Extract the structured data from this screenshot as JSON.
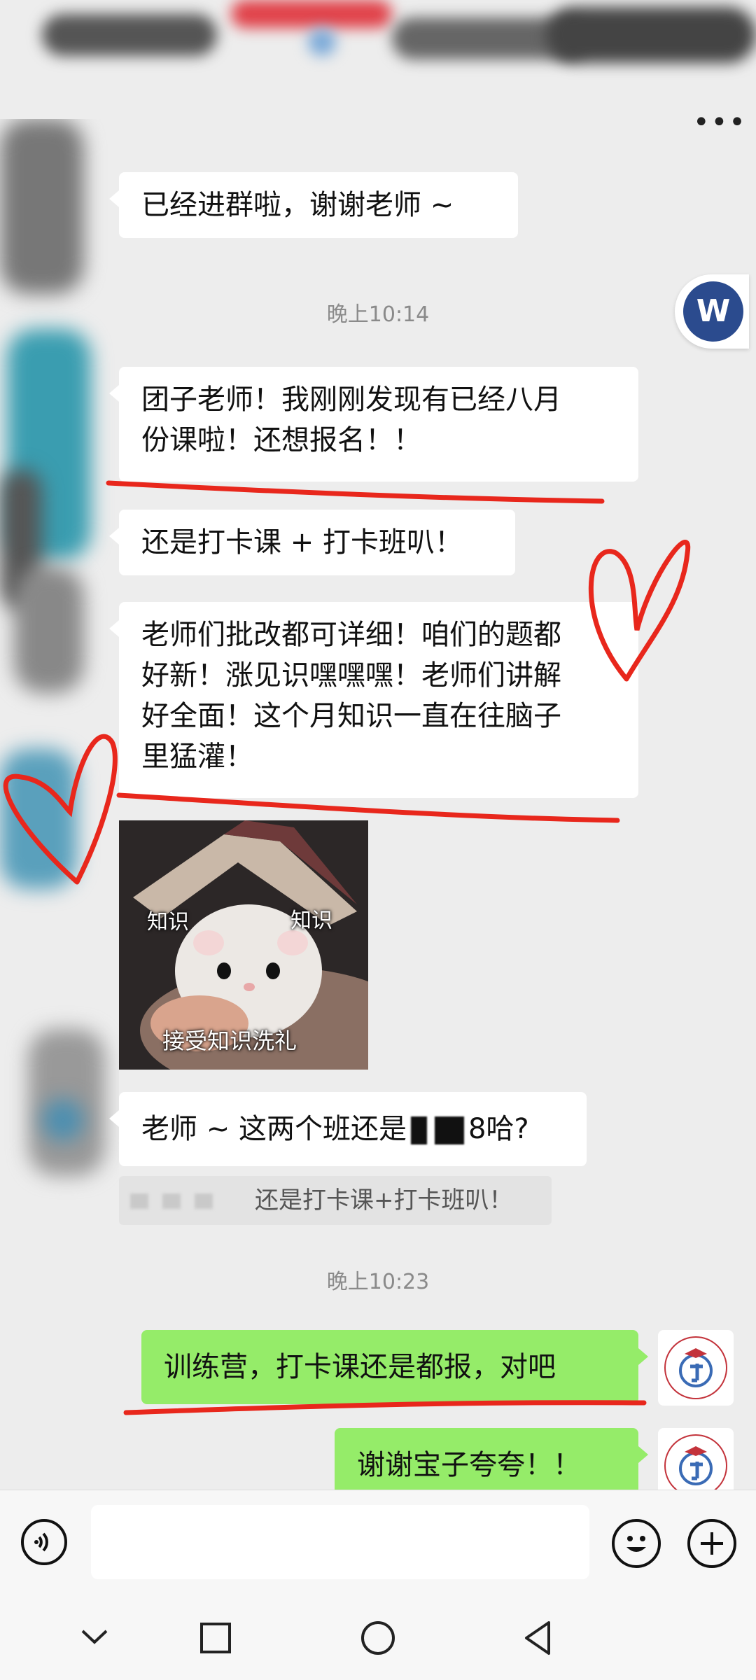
{
  "header": {
    "more_icon": "more-dots-icon"
  },
  "badge": {
    "letter": "W"
  },
  "messages": {
    "m1": "已经进群啦，谢谢老师 ~",
    "t1": "晚上10:14",
    "m2_line1": "团子老师！我刚刚发现有已经八月",
    "m2_line2": "份课啦！还想报名！！",
    "m3": "还是打卡课 + 打卡班叭！",
    "m4_line1": "老师们批改都可详细！咱们的题都",
    "m4_line2": "好新！涨见识嘿嘿嘿！老师们讲解",
    "m4_line3": "好全面！这个月知识一直在往脑子",
    "m4_line4": "里猛灌！",
    "sticker_label_left": "知识",
    "sticker_label_right": "知识",
    "sticker_caption": "接受知识洗礼",
    "m5_prefix": "老师 ~ 这两个班还是",
    "m5_suffix": "8哈?",
    "quote_text": "还是打卡课+打卡班叭！",
    "t2": "晚上10:23",
    "m6": "训练营，打卡课还是都报，对吧",
    "m7": "谢谢宝子夸夸！！"
  },
  "annotations": {
    "underline_color": "#e8271c",
    "heart_color": "#e8271c"
  },
  "input_bar": {
    "voice_icon": "voice-icon",
    "emoji_icon": "emoji-icon",
    "plus_icon": "plus-icon"
  },
  "nav": {
    "back_icon": "chevron-down-icon",
    "recent_icon": "square-icon",
    "home_icon": "circle-icon",
    "back2_icon": "triangle-back-icon"
  }
}
